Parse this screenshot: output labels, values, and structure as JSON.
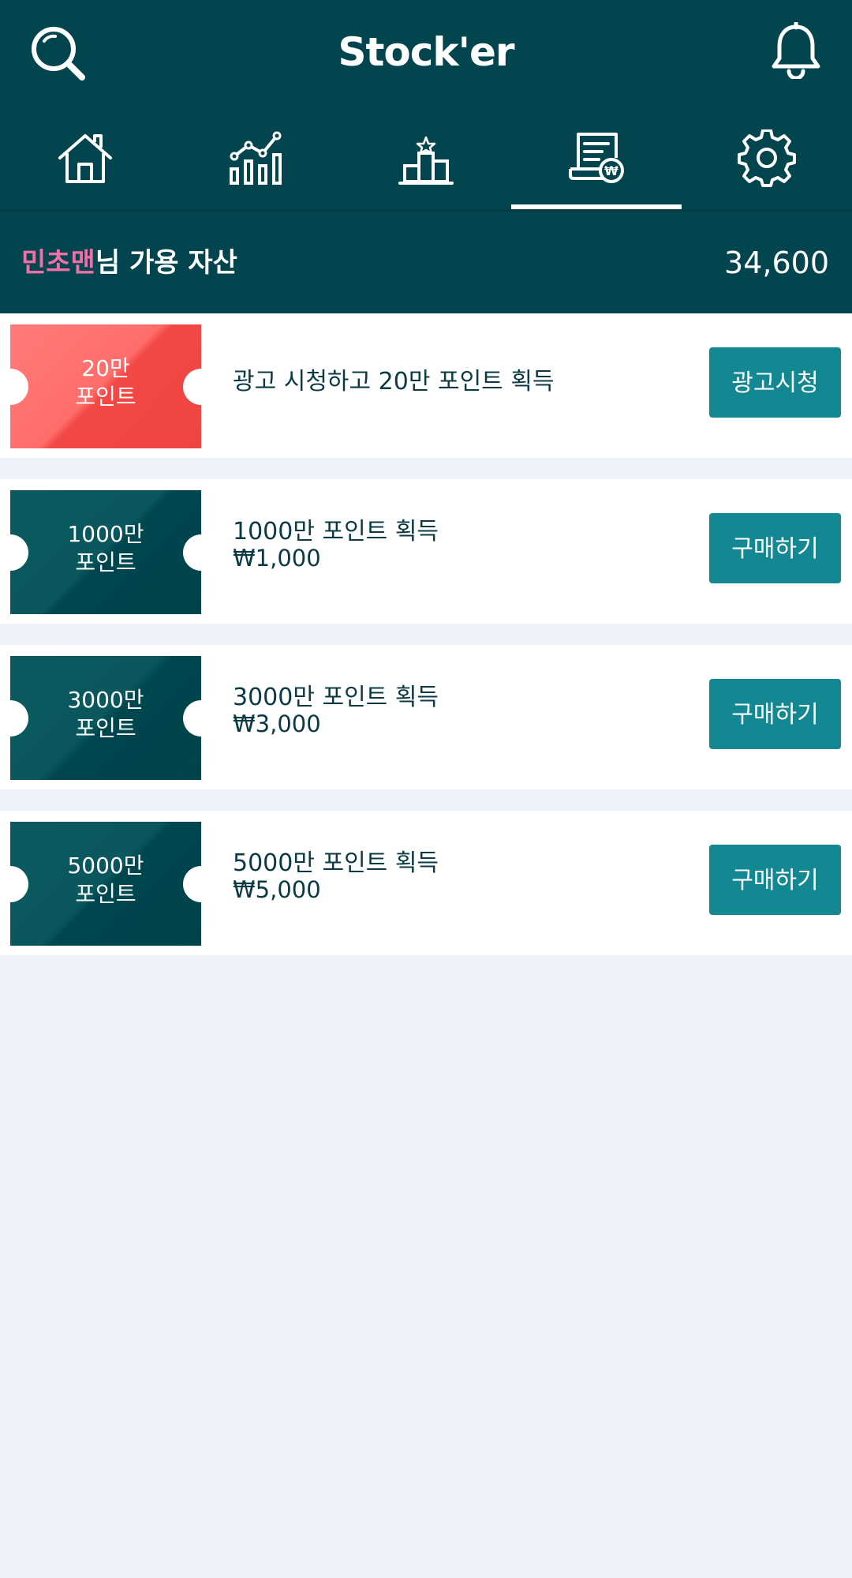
{
  "app": {
    "title": "Stock'er"
  },
  "header": {
    "search_icon": "search-icon",
    "bell_icon": "bell-icon"
  },
  "nav": {
    "tabs": [
      {
        "name": "home",
        "icon": "home-icon"
      },
      {
        "name": "chart",
        "icon": "line-chart-icon"
      },
      {
        "name": "ranking",
        "icon": "ranking-podium-icon"
      },
      {
        "name": "shop",
        "icon": "receipt-won-icon",
        "active": true
      },
      {
        "name": "settings",
        "icon": "gear-icon"
      }
    ]
  },
  "asset": {
    "user_name": "민초맨",
    "label_suffix": "님 가용 자산",
    "value": "34,600"
  },
  "items": [
    {
      "ticket_line1": "20만",
      "ticket_line2": "포인트",
      "title": "광고 시청하고 20만 포인트 획득",
      "price": "",
      "button": "광고시청",
      "style": "red"
    },
    {
      "ticket_line1": "1000만",
      "ticket_line2": "포인트",
      "title": "1000만 포인트 획득",
      "price": "₩1,000",
      "button": "구매하기",
      "style": "teal"
    },
    {
      "ticket_line1": "3000만",
      "ticket_line2": "포인트",
      "title": "3000만 포인트 획득",
      "price": "₩3,000",
      "button": "구매하기",
      "style": "teal"
    },
    {
      "ticket_line1": "5000만",
      "ticket_line2": "포인트",
      "title": "5000만 포인트 획득",
      "price": "₩5,000",
      "button": "구매하기",
      "style": "teal"
    }
  ],
  "colors": {
    "header_bg": "#02454f",
    "accent_pink": "#f06fa6",
    "button_bg": "#138792",
    "ticket_red": "#f24846",
    "ticket_teal": "#0a585e",
    "page_bg": "#eef2f9"
  }
}
